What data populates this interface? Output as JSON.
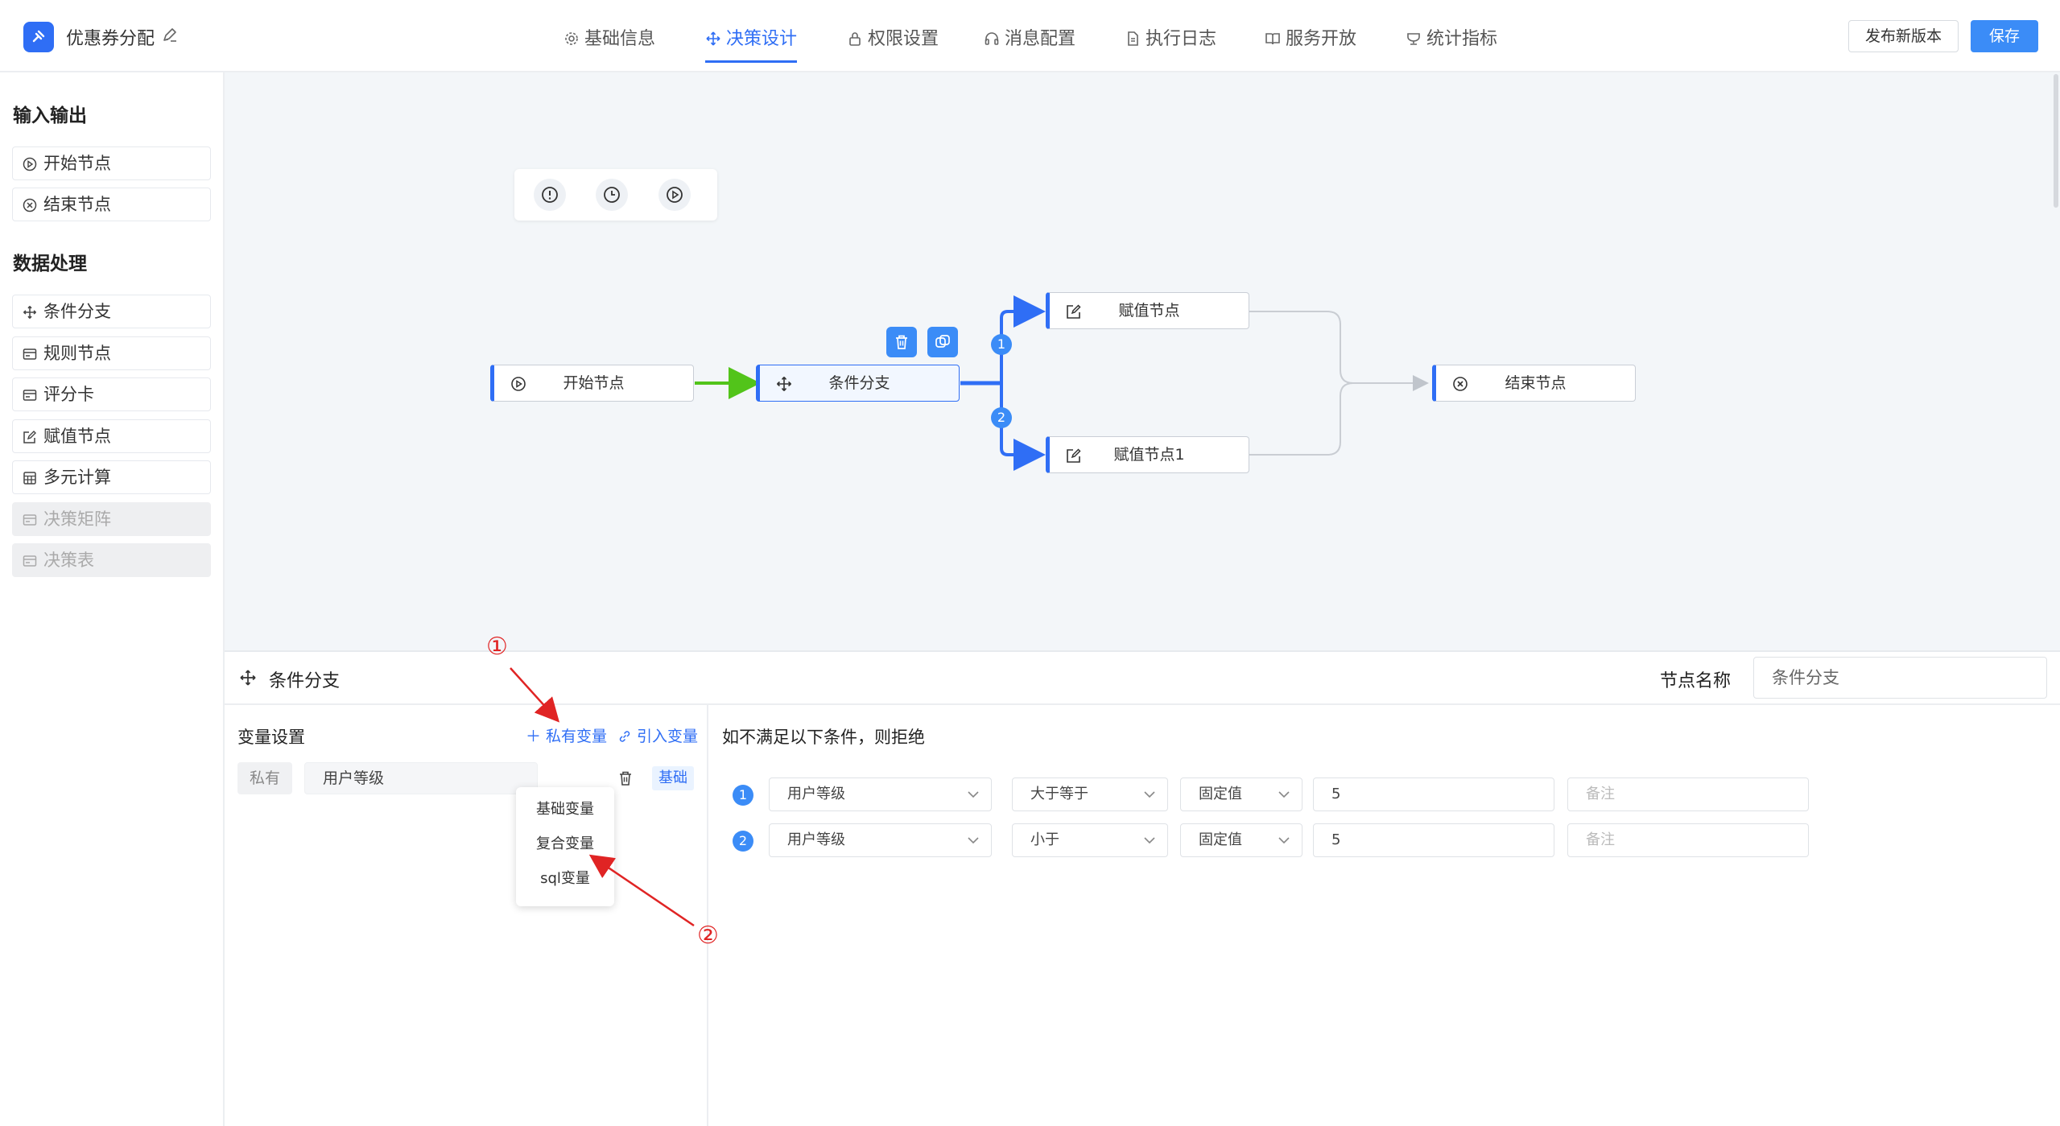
{
  "app": {
    "title": "优惠券分配"
  },
  "nav": {
    "tabs": [
      {
        "label": "基础信息",
        "icon": "gear-icon"
      },
      {
        "label": "决策设计",
        "icon": "move-icon",
        "active": true
      },
      {
        "label": "权限设置",
        "icon": "lock-icon"
      },
      {
        "label": "消息配置",
        "icon": "headset-icon"
      },
      {
        "label": "执行日志",
        "icon": "document-icon"
      },
      {
        "label": "服务开放",
        "icon": "book-icon"
      },
      {
        "label": "统计指标",
        "icon": "trophy-icon"
      }
    ]
  },
  "actions": {
    "publish_label": "发布新版本",
    "save_label": "保存"
  },
  "colors": {
    "accent": "#2f6ef5",
    "primary_button": "#3b8cf7",
    "canvas_bg": "#f3f6f9",
    "success_edge": "#52c41a",
    "annotation": "#e02424"
  },
  "sidebar": {
    "groups": [
      {
        "title": "输入输出",
        "items": [
          {
            "label": "开始节点",
            "icon": "play-circle-icon",
            "disabled": false
          },
          {
            "label": "结束节点",
            "icon": "close-circle-icon",
            "disabled": false
          }
        ]
      },
      {
        "title": "数据处理",
        "items": [
          {
            "label": "条件分支",
            "icon": "move-icon",
            "disabled": false
          },
          {
            "label": "规则节点",
            "icon": "card-icon",
            "disabled": false
          },
          {
            "label": "评分卡",
            "icon": "card-icon",
            "disabled": false
          },
          {
            "label": "赋值节点",
            "icon": "edit-icon",
            "disabled": false
          },
          {
            "label": "多元计算",
            "icon": "calculator-icon",
            "disabled": false
          },
          {
            "label": "决策矩阵",
            "icon": "card-icon",
            "disabled": true
          },
          {
            "label": "决策表",
            "icon": "card-icon",
            "disabled": true
          }
        ]
      }
    ]
  },
  "canvas": {
    "toolbar": [
      "alert-icon",
      "clock-icon",
      "play-icon"
    ],
    "nodes": {
      "start": "开始节点",
      "condition": "条件分支",
      "assign1": "赋值节点",
      "assign2": "赋值节点1",
      "end": "结束节点"
    },
    "branch_badges": [
      "1",
      "2"
    ]
  },
  "panel": {
    "title": "条件分支",
    "node_name_label": "节点名称",
    "node_name_value": "条件分支",
    "variables": {
      "title": "变量设置",
      "add_private_label": "私有变量",
      "import_label": "引入变量",
      "rows": [
        {
          "scope": "私有",
          "name": "用户等级",
          "type": "基础"
        }
      ],
      "dropdown": [
        "基础变量",
        "复合变量",
        "sql变量"
      ]
    },
    "conditions": {
      "hint": "如不满足以下条件，则拒绝",
      "rows": [
        {
          "num": "1",
          "field": "用户等级",
          "operator": "大于等于",
          "value_type": "固定值",
          "value": "5",
          "note_placeholder": "备注"
        },
        {
          "num": "2",
          "field": "用户等级",
          "operator": "小于",
          "value_type": "固定值",
          "value": "5",
          "note_placeholder": "备注"
        }
      ]
    }
  },
  "annotations": [
    "①",
    "②"
  ]
}
